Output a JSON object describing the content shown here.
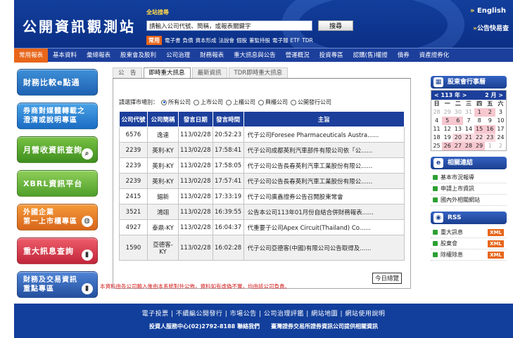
{
  "header": {
    "site_title": "公開資訊觀測站",
    "search_label": "全站搜尋",
    "search_placeholder": "請輸入公司代號、簡稱，或報表關鍵字",
    "search_button": "搜尋",
    "quick_tag": "常用",
    "quick_links": [
      "電子書",
      "",
      "負債",
      "資本形成",
      "法說會",
      "個股",
      "董監持股",
      "電子報",
      "",
      "ETF",
      "TDR"
    ],
    "lang_link": "English",
    "faq_link": "公告快易查"
  },
  "nav": [
    "常用報表",
    "基本資料",
    "彙總報表",
    "股東會及股利",
    "公司治理",
    "財務報表",
    "重大訊息與公告",
    "營運概況",
    "投資專區",
    "認購(售)權證",
    "債券",
    "資產證券化"
  ],
  "banners": [
    {
      "line1": "財務比較e點通",
      "line2": ""
    },
    {
      "line1": "券商對媒體轉載之",
      "line2": "澄清或說明專區"
    },
    {
      "line1": "月營收資訊查詢",
      "line2": ""
    },
    {
      "line1": "XBRL資訊平台",
      "line2": ""
    },
    {
      "line1": "外國企業",
      "line2": "第一上市櫃專區"
    },
    {
      "line1": "重大訊息查詢",
      "line2": ""
    },
    {
      "line1": "財務及交易資訊",
      "line2": "重點專區"
    }
  ],
  "tabs": [
    "公　告",
    "即時重大訊息",
    "最新資訊",
    "TDR即時重大訊息"
  ],
  "filter": {
    "label": "請選擇市場別：",
    "options": [
      "所有公司",
      "上市公司",
      "上櫃公司",
      "興櫃公司",
      "公開發行公司"
    ],
    "selected": 0
  },
  "table": {
    "headers": [
      "公司代號",
      "公司簡稱",
      "發言日期",
      "發言時間",
      "主旨"
    ],
    "rows": [
      [
        "6576",
        "逸達",
        "113/02/28",
        "20:52:23",
        "代子公司Foresee Pharmaceuticals Austra......"
      ],
      [
        "2239",
        "英利-KY",
        "113/02/28",
        "17:58:41",
        "代子公司成都英利汽車部件有限公司依「公......"
      ],
      [
        "2239",
        "英利-KY",
        "113/02/28",
        "17:58:05",
        "代子公司公告長春英利汽車工業股份有限公......"
      ],
      [
        "2239",
        "英利-KY",
        "113/02/28",
        "17:57:41",
        "代子公司公告長春英利汽車工業股份有限公......"
      ],
      [
        "2415",
        "錩新",
        "113/02/28",
        "17:33:19",
        "代子公司廣鑫證券公告召開股東常會"
      ],
      [
        "3521",
        "鴻翊",
        "113/02/28",
        "16:39:55",
        "公告本公司113年01月份自結合併財務報表......"
      ],
      [
        "4927",
        "泰鼎-KY",
        "113/02/28",
        "16:04:37",
        "代重要子公司Apex Circuit(Thailand) Co......"
      ],
      [
        "1590",
        "亞德客-KY",
        "113/02/28",
        "16:02:28",
        "代子公司亞德客(中國)有限公司公告取得及......"
      ]
    ],
    "more_button": "今日總覽"
  },
  "disclaimer": "本資料由各公司輸入後由本系統對外公佈，資料如有虛偽不實，均由該公司負責。",
  "right": {
    "calendar_title": "股東會行事曆",
    "year_label": "113 年",
    "month_label": "2 月",
    "weekdays": [
      "日",
      "一",
      "二",
      "三",
      "四",
      "五",
      "六"
    ],
    "days": [
      [
        "28",
        "29",
        "30",
        "31",
        "1",
        "2",
        "3"
      ],
      [
        "4",
        "5",
        "6",
        "7",
        "8",
        "9",
        "10"
      ],
      [
        "11",
        "12",
        "13",
        "14",
        "15",
        "16",
        "17"
      ],
      [
        "18",
        "19",
        "20",
        "21",
        "22",
        "23",
        "24"
      ],
      [
        "25",
        "26",
        "27",
        "28",
        "29",
        "1",
        "2"
      ]
    ],
    "links_title": "相關連結",
    "links": [
      "基本市況報導",
      "申請上市資訊",
      "國內外相關網站"
    ],
    "rss_title": "RSS",
    "rss_items": [
      "重大訊息",
      "股東會",
      "除權除息"
    ],
    "xml_label": "XML"
  },
  "footer": {
    "links": "電子投票 | 不續編公開發行 | 市場公告 | 公司治理評鑑 | 網站地圖 | 網站使用說明",
    "info": "投資人服務中心(02)2792-8188  聯絡我們　　臺灣證券交易所證券資訊公司提供相關資訊"
  }
}
